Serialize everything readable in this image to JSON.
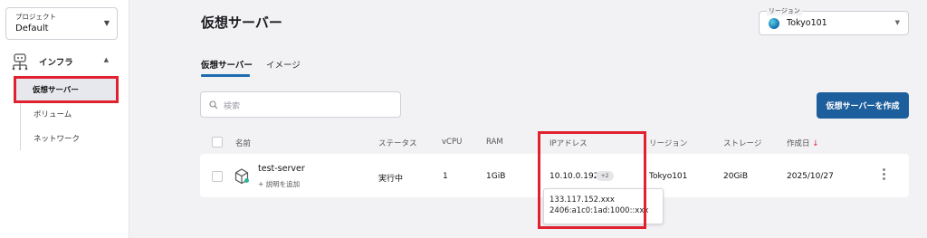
{
  "sidebar": {
    "project": {
      "label": "プロジェクト",
      "value": "Default"
    },
    "section": {
      "label": "インフラ"
    },
    "items": [
      {
        "label": "仮想サーバー"
      },
      {
        "label": "ボリューム"
      },
      {
        "label": "ネットワーク"
      }
    ]
  },
  "header": {
    "title": "仮想サーバー",
    "region": {
      "label": "リージョン",
      "value": "Tokyo101"
    }
  },
  "tabs": [
    {
      "label": "仮想サーバー"
    },
    {
      "label": "イメージ"
    }
  ],
  "toolbar": {
    "search_placeholder": "検索",
    "create_label": "仮想サーバーを作成"
  },
  "table": {
    "columns": {
      "name": "名前",
      "status": "ステータス",
      "vcpu": "vCPU",
      "ram": "RAM",
      "ip": "IPアドレス",
      "region": "リージョン",
      "storage": "ストレージ",
      "created": "作成日"
    },
    "rows": [
      {
        "name": "test-server",
        "add_description": "+ 説明を追加",
        "status": "実行中",
        "vcpu": "1",
        "ram": "1GiB",
        "ip": "10.10.0.192",
        "ip_more": "+2",
        "region": "Tokyo101",
        "storage": "20GiB",
        "created": "2025/10/27"
      }
    ]
  },
  "ip_tooltip": {
    "lines": [
      "133.117.152.xxx",
      "2406:a1c0:1ad:1000::xxx"
    ]
  },
  "colors": {
    "primary": "#1d5e9c",
    "highlight": "#e02230",
    "status_running": "#2bb39b"
  }
}
